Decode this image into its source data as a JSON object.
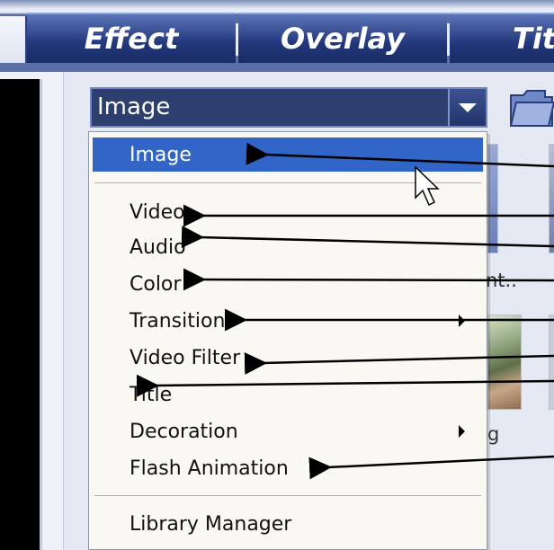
{
  "tabs": [
    {
      "label": "Effect"
    },
    {
      "label": "Overlay"
    },
    {
      "label": "Tit"
    }
  ],
  "library": {
    "combo_value": "Image",
    "dropdown_icon": "chevron-down-icon",
    "folder_icon": "folder-icon"
  },
  "background_thumbs": {
    "label_1": "nt..",
    "label_2": "g"
  },
  "menu": {
    "items": [
      {
        "label": "Image",
        "selected": true,
        "submenu": false
      },
      {
        "label": "Video",
        "selected": false,
        "submenu": false
      },
      {
        "label": "Audio",
        "selected": false,
        "submenu": false
      },
      {
        "label": "Color",
        "selected": false,
        "submenu": false
      },
      {
        "label": "Transition",
        "selected": false,
        "submenu": true
      },
      {
        "label": "Video Filter",
        "selected": false,
        "submenu": false
      },
      {
        "label": "Title",
        "selected": false,
        "submenu": false
      },
      {
        "label": "Decoration",
        "selected": false,
        "submenu": true
      },
      {
        "label": "Flash Animation",
        "selected": false,
        "submenu": false
      },
      {
        "label": "Library Manager",
        "selected": false,
        "submenu": false
      }
    ]
  },
  "colors": {
    "tab_bg": "#22377a",
    "combo_bg": "#2c3f6e",
    "selection": "#3265c8",
    "menu_bg": "#f9f8f3"
  }
}
